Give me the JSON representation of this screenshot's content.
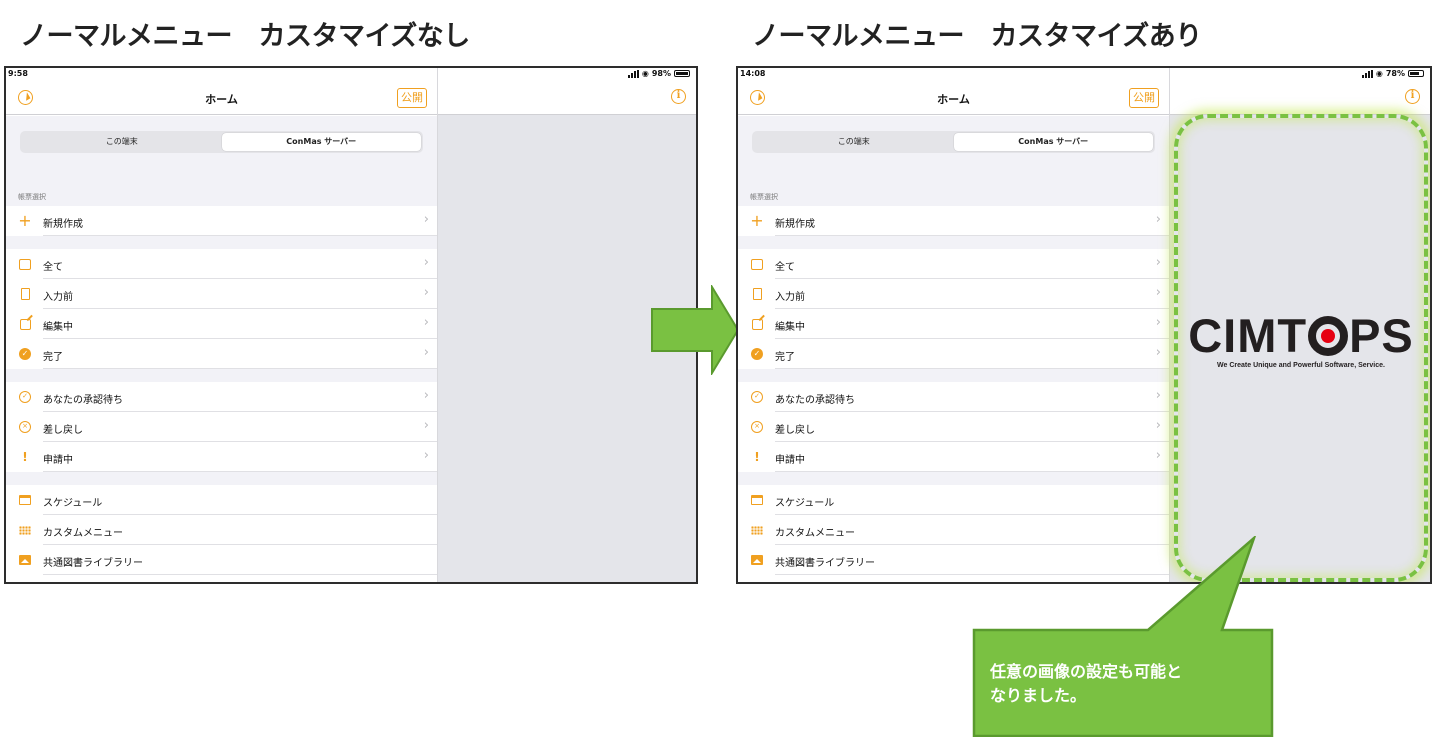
{
  "headings": {
    "left": "ノーマルメニュー　カスタマイズなし",
    "right": "ノーマルメニュー　カスタマイズあり"
  },
  "screens": [
    {
      "status": {
        "time": "9:58",
        "battery": "98%",
        "battery_level": 0.98
      },
      "nav": {
        "title": "ホーム",
        "publish_label": "公開"
      },
      "segments": {
        "local": "この端末",
        "server": "ConMas サーバー",
        "active": "server"
      },
      "section_label": "帳票選択",
      "groups": [
        [
          {
            "icon": "plus-icon",
            "label": "新規作成"
          }
        ],
        [
          {
            "icon": "inbox-icon",
            "label": "全て"
          },
          {
            "icon": "document-icon",
            "label": "入力前"
          },
          {
            "icon": "edit-icon",
            "label": "編集中"
          },
          {
            "icon": "check-badge-icon",
            "label": "完了"
          }
        ],
        [
          {
            "icon": "check-circle-icon",
            "label": "あなたの承認待ち"
          },
          {
            "icon": "x-circle-icon",
            "label": "差し戻し"
          },
          {
            "icon": "exclamation-icon",
            "label": "申請中"
          }
        ],
        [
          {
            "icon": "calendar-icon",
            "label": "スケジュール"
          },
          {
            "icon": "grid-icon",
            "label": "カスタムメニュー"
          },
          {
            "icon": "image-icon",
            "label": "共通図書ライブラリー"
          }
        ]
      ]
    },
    {
      "status": {
        "time": "14:08",
        "battery": "78%",
        "battery_level": 0.78
      },
      "nav": {
        "title": "ホーム",
        "publish_label": "公開"
      },
      "segments": {
        "local": "この端末",
        "server": "ConMas サーバー",
        "active": "server"
      },
      "section_label": "帳票選択",
      "groups": [
        [
          {
            "icon": "plus-icon",
            "label": "新規作成"
          }
        ],
        [
          {
            "icon": "inbox-icon",
            "label": "全て"
          },
          {
            "icon": "document-icon",
            "label": "入力前"
          },
          {
            "icon": "edit-icon",
            "label": "編集中"
          },
          {
            "icon": "check-badge-icon",
            "label": "完了"
          }
        ],
        [
          {
            "icon": "check-circle-icon",
            "label": "あなたの承認待ち"
          },
          {
            "icon": "x-circle-icon",
            "label": "差し戻し"
          },
          {
            "icon": "exclamation-icon",
            "label": "申請中"
          }
        ],
        [
          {
            "icon": "calendar-icon",
            "label": "スケジュール"
          },
          {
            "icon": "grid-icon",
            "label": "カスタムメニュー"
          },
          {
            "icon": "image-icon",
            "label": "共通図書ライブラリー"
          }
        ]
      ]
    }
  ],
  "logo": {
    "word_before": "CIMT",
    "word_after": "PS",
    "tagline": "We Create Unique and Powerful Software, Service."
  },
  "callout": {
    "line1": "任意の画像の設定も可能と",
    "line2": "なりました。"
  },
  "colors": {
    "accent": "#f0a020",
    "arrow_green": "#7ac142",
    "logo_red": "#e60012",
    "detail_gray": "#e4e5ea"
  }
}
